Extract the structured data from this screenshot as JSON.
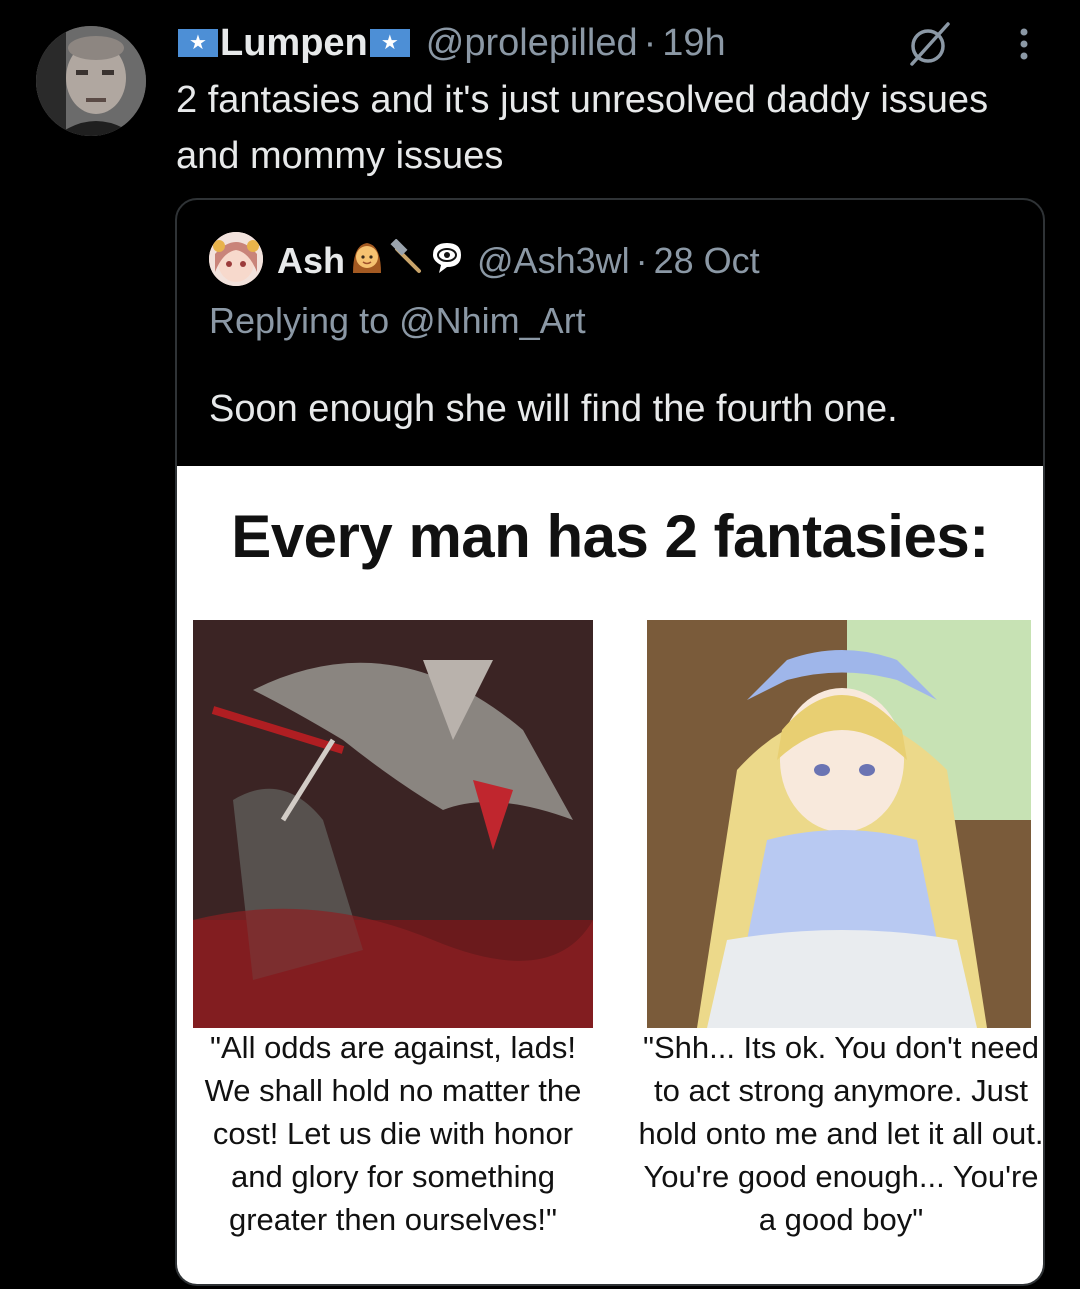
{
  "post": {
    "display_name": "Lumpen",
    "handle": "@prolepilled",
    "separator": "·",
    "time": "19h",
    "text": "2 fantasies and it's just unresolved daddy issues and mommy issues",
    "avatar_icon": "user-avatar-photo",
    "menu_icon": "more-vertical-icon",
    "extra_icon": "grok-icon"
  },
  "quoted": {
    "display_name": "Ash",
    "handle": "@Ash3wl",
    "separator": "·",
    "date": "28 Oct",
    "reply_prefix": "Replying to ",
    "reply_to": "@Nhim_Art",
    "text": "Soon enough she will find the fourth one.",
    "name_emojis": [
      "girl-emoji",
      "hammer-emoji",
      "eye-speech-emoji"
    ]
  },
  "meme": {
    "title": "Every man has 2 fantasies:",
    "left_caption": "\"All odds are against, lads! We shall hold no matter the cost! Let us die with honor and glory for something greater then ourselves!\"",
    "right_caption": "\"Shh... Its ok. You don't need to act strong anymore. Just hold onto me and let it all out. You're good enough... You're a good boy\""
  },
  "colors": {
    "background": "#000000",
    "text_primary": "#e7e9ea",
    "text_secondary": "#8b98a5",
    "border": "#2f3336",
    "flag_blue": "#4d8fd6"
  }
}
